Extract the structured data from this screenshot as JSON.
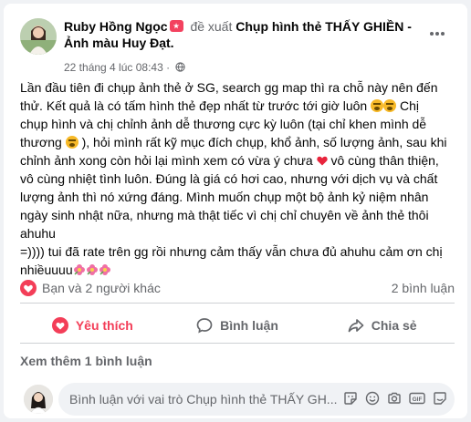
{
  "post": {
    "author": "Ruby Hồng Ngọc",
    "verb": "đề xuất",
    "target": "Chụp hình thẻ THẤY GHIỀN - Ảnh màu Huy Đạt.",
    "time": "22 tháng 4 lúc 08:43",
    "privacy_icon": "globe-icon",
    "text_lines": [
      "Lần đầu tiên đi chụp ảnh thẻ ở SG, search gg map thì ra chỗ này nên đến",
      "thử. Kết quả là có tấm hình thẻ đẹp nhất từ trước tới giờ luôn",
      "Chị",
      "chụp hình và chị chỉnh ảnh dễ thương cực kỳ luôn (tại chỉ khen mình dễ",
      "thương",
      "), hỏi mình rất kỹ mục đích chụp, khổ ảnh, số lượng ảnh, sau khi",
      "chỉnh ảnh xong còn hỏi lại mình xem có vừa ý chưa",
      "vô cùng thân thiện,",
      "vô cùng nhiệt tình luôn. Đúng là giá có hơi cao, nhưng với dịch vụ và chất",
      "lượng ảnh thì nó xứng đáng. Mình muốn chụp một bộ ảnh kỷ niệm nhân",
      "ngày sinh nhật nữa, nhưng mà thật tiếc vì chị chỉ chuyên về ảnh thẻ thôi",
      "ahuhu",
      "=)))) tui đã rate trên gg rồi nhưng cảm thấy vẫn chưa đủ ahuhu cảm ơn chị",
      "nhiềuuuu"
    ]
  },
  "stats": {
    "reactors": "Bạn và 2 người khác",
    "comments": "2 bình luận"
  },
  "actions": {
    "like": "Yêu thích",
    "comment": "Bình luận",
    "share": "Chia sẻ"
  },
  "comments": {
    "view_more": "Xem thêm 1 bình luận",
    "placeholder": "Bình luận với vai trò Chụp hình thẻ THẤY GH..."
  },
  "colors": {
    "love": "#f33e58",
    "secondary_text": "#65676b"
  }
}
